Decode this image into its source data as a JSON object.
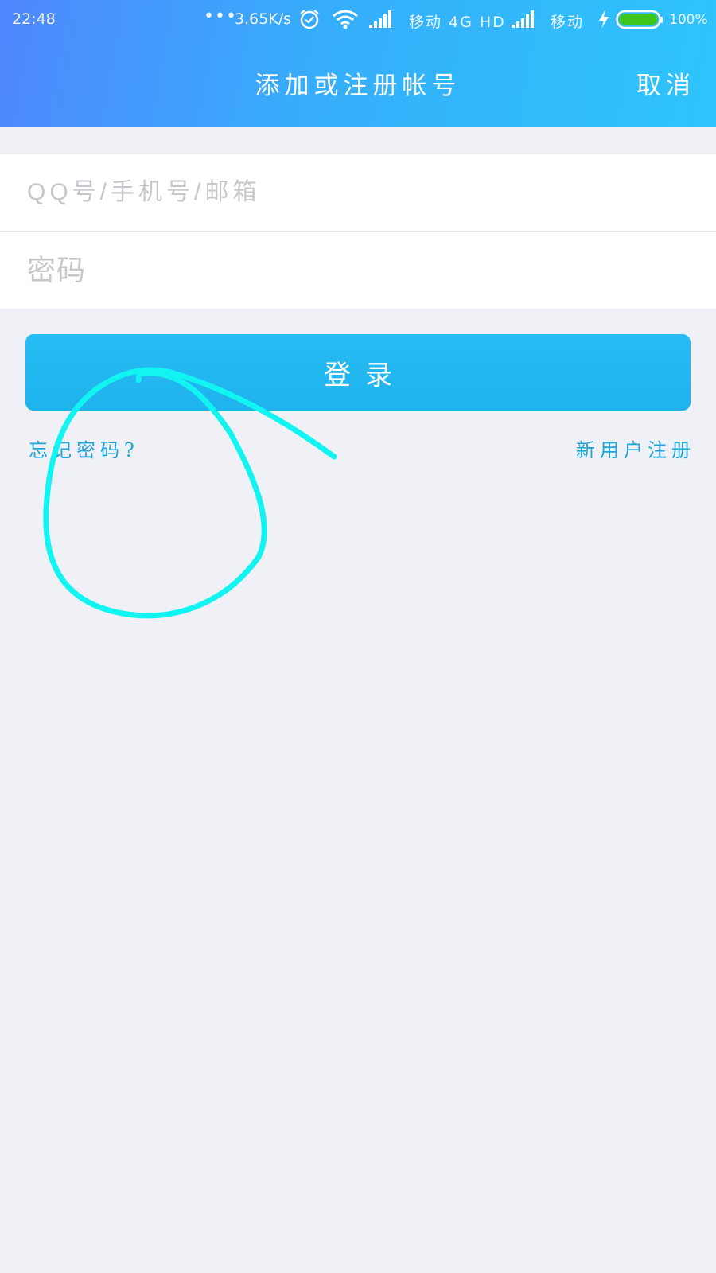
{
  "status_bar": {
    "time": "22:48",
    "dots": "•••",
    "net_speed": "3.65K/s",
    "carrier1": "移动 4G HD",
    "carrier2": "移动",
    "battery": "100%",
    "battery_color": "#3fc61d"
  },
  "nav": {
    "title": "添加或注册帐号",
    "cancel": "取消"
  },
  "form": {
    "account_placeholder": "QQ号/手机号/邮箱",
    "password_placeholder": "密码"
  },
  "actions": {
    "login": "登录",
    "forgot_password": "忘记密码?",
    "register": "新用户注册"
  },
  "colors": {
    "accent": "#1eb3ec",
    "link": "#1ea5d8",
    "annotation": "#12f4f2",
    "background": "#eff1f6"
  }
}
